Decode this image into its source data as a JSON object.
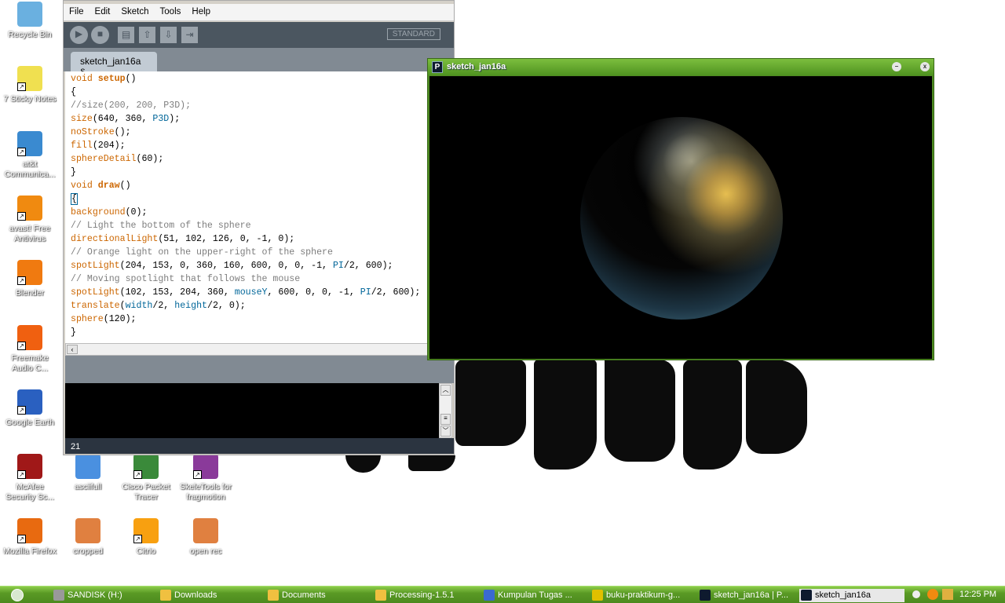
{
  "desktop": {
    "icons": [
      {
        "label": "Recycle Bin",
        "color": "#6ab0e0"
      },
      {
        "label": "7 Sticky Notes",
        "color": "#f0e050"
      },
      {
        "label": "at&t Communica...",
        "color": "#3a8ad0"
      },
      {
        "label": "avast! Free Antivirus",
        "color": "#f08a10"
      },
      {
        "label": "Blender",
        "color": "#f07a10"
      },
      {
        "label": "Freemake Audio C...",
        "color": "#f06010"
      },
      {
        "label": "Google Earth",
        "color": "#2a60c0"
      },
      {
        "label": "McAfee Security Sc...",
        "color": "#a01818"
      },
      {
        "label": "Mozilla Firefox",
        "color": "#e86a10"
      },
      {
        "label": "asciifull",
        "color": "#4a90e0"
      },
      {
        "label": "Cisco Packet Tracer",
        "color": "#3a8a3a"
      },
      {
        "label": "SkeleTools for fragmotion",
        "color": "#8a3a9a"
      },
      {
        "label": "cropped",
        "color": "#e08040"
      },
      {
        "label": "Citrio",
        "color": "#f8a010"
      },
      {
        "label": "open rec",
        "color": "#e08040"
      }
    ]
  },
  "ide": {
    "menu": [
      "File",
      "Edit",
      "Sketch",
      "Tools",
      "Help"
    ],
    "toolbar": {
      "run": "▶",
      "stop": "■",
      "new": "▤",
      "open": "⇧",
      "save": "⇩",
      "export": "⇥",
      "mode": "STANDARD"
    },
    "tab": "sketch_jan16a §",
    "code": [
      [
        [
          "void ",
          "kw"
        ],
        [
          "setup",
          "kwb"
        ],
        [
          "()",
          ""
        ]
      ],
      [
        [
          "{",
          ""
        ]
      ],
      [
        [
          "//size(200, 200, P3D);",
          "cm"
        ]
      ],
      [
        [
          "size",
          "kw"
        ],
        [
          "(640, 360, ",
          ""
        ],
        [
          "P3D",
          "cn"
        ],
        [
          ");",
          ""
        ]
      ],
      [
        [
          "noStroke",
          "kw"
        ],
        [
          "();",
          ""
        ]
      ],
      [
        [
          "fill",
          "kw"
        ],
        [
          "(204);",
          ""
        ]
      ],
      [
        [
          "sphereDetail",
          "kw"
        ],
        [
          "(60);",
          ""
        ]
      ],
      [
        [
          "}",
          ""
        ]
      ],
      [
        [
          "void ",
          "kw"
        ],
        [
          "draw",
          "kwb"
        ],
        [
          "()",
          ""
        ]
      ],
      [
        [
          "{",
          "caret"
        ]
      ],
      [
        [
          "background",
          "kw"
        ],
        [
          "(0);",
          ""
        ]
      ],
      [
        [
          "// Light the bottom of the sphere",
          "cm"
        ]
      ],
      [
        [
          "directionalLight",
          "kw"
        ],
        [
          "(51, 102, 126, 0, -1, 0);",
          ""
        ]
      ],
      [
        [
          "// Orange light on the upper-right of the sphere",
          "cm"
        ]
      ],
      [
        [
          "spotLight",
          "kw"
        ],
        [
          "(204, 153, 0, 360, 160, 600, 0, 0, -1, ",
          ""
        ],
        [
          "PI",
          "cn"
        ],
        [
          "/2, 600);",
          ""
        ]
      ],
      [
        [
          "// Moving spotlight that follows the mouse",
          "cm"
        ]
      ],
      [
        [
          "spotLight",
          "kw"
        ],
        [
          "(102, 153, 204, 360, ",
          ""
        ],
        [
          "mouseY",
          "cn"
        ],
        [
          ", 600, 0, 0, -1, ",
          ""
        ],
        [
          "PI",
          "cn"
        ],
        [
          "/2, 600);",
          ""
        ]
      ],
      [
        [
          "translate",
          "kw"
        ],
        [
          "(",
          ""
        ],
        [
          "width",
          "cn"
        ],
        [
          "/2, ",
          ""
        ],
        [
          "height",
          "cn"
        ],
        [
          "/2, 0);",
          ""
        ]
      ],
      [
        [
          "sphere",
          "kw"
        ],
        [
          "(120);",
          ""
        ]
      ],
      [
        [
          "}",
          ""
        ]
      ]
    ],
    "status_line": "21"
  },
  "sketch_window": {
    "title": "sketch_jan16a",
    "icon_letter": "P",
    "minimize": "–",
    "close": "x"
  },
  "taskbar": {
    "items": [
      {
        "label": "SANDISK (H:)",
        "color": "#999"
      },
      {
        "label": "Downloads",
        "color": "#f0c040"
      },
      {
        "label": "Documents",
        "color": "#f0c040"
      },
      {
        "label": "Processing-1.5.1",
        "color": "#f0c040"
      },
      {
        "label": "Kumpulan Tugas ...",
        "color": "#3a6ad0"
      },
      {
        "label": "buku-praktikum-g...",
        "color": "#e0c000"
      },
      {
        "label": "sketch_jan16a | P...",
        "color": "#0e1a2e"
      },
      {
        "label": "sketch_jan16a",
        "color": "#0e1a2e"
      }
    ],
    "clock": "12:25 PM"
  }
}
